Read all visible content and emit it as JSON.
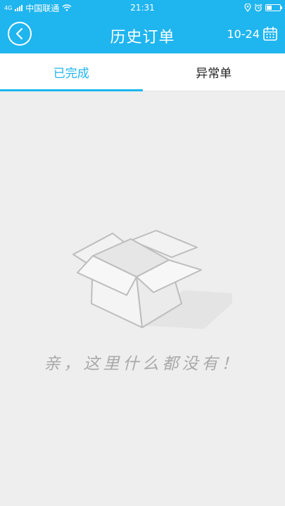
{
  "status_bar": {
    "network_type": "4G",
    "carrier": "中国联通",
    "time": "21:31"
  },
  "header": {
    "title": "历史订单",
    "date": "10-24"
  },
  "tabs": [
    {
      "label": "已完成",
      "active": true
    },
    {
      "label": "异常单",
      "active": false
    }
  ],
  "empty_state": {
    "message": "亲，这里什么都没有！"
  },
  "colors": {
    "primary": "#1fb5ef",
    "background": "#eeeeee",
    "empty_text": "#a9a9a9"
  },
  "icons": {
    "back": "chevron-left-in-circle",
    "calendar": "calendar-icon",
    "empty": "open-box-icon"
  }
}
